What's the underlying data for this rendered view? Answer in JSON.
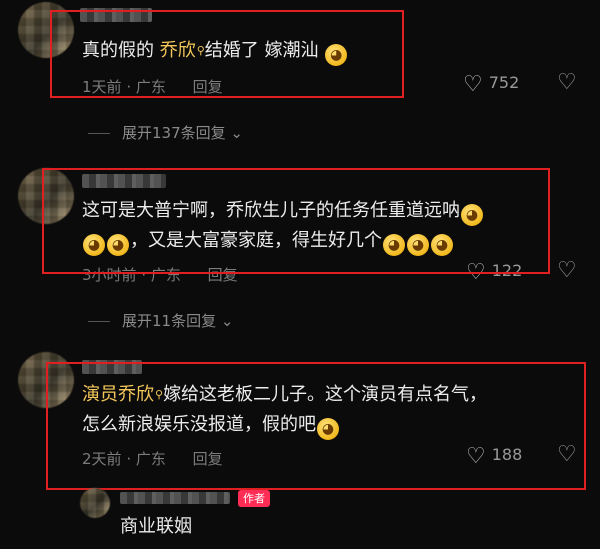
{
  "comments": [
    {
      "line1_pre": "真的假的 ",
      "line1_hl": "乔欣",
      "line1_post": "结婚了 嫁潮汕",
      "time": "1天前",
      "location": "广东",
      "reply_label": "回复",
      "likes": "752",
      "expand_label": "展开137条回复"
    },
    {
      "line1": "这可是大普宁啊，乔欣生儿子的任务任重道远呐",
      "line2": "，又是大富豪家庭，得生好几个",
      "time": "3小时前",
      "location": "广东",
      "reply_label": "回复",
      "likes": "122",
      "expand_label": "展开11条回复"
    },
    {
      "line1_hl": "演员乔欣",
      "line1_post": "嫁给这老板二儿子。这个演员有点名气，",
      "line2": "怎么新浪娱乐没报道，假的吧",
      "time": "2天前",
      "location": "广东",
      "reply_label": "回复",
      "likes": "188"
    }
  ],
  "reply": {
    "author_badge": "作者",
    "text": "商业联姻"
  },
  "colors": {
    "highlight": "#f3c75a",
    "box": "#e02020",
    "badge": "#ff2c55"
  },
  "icons": [
    "search-icon",
    "heart-icon",
    "broken-heart-icon",
    "chevron-down-icon",
    "emoji-icon"
  ]
}
